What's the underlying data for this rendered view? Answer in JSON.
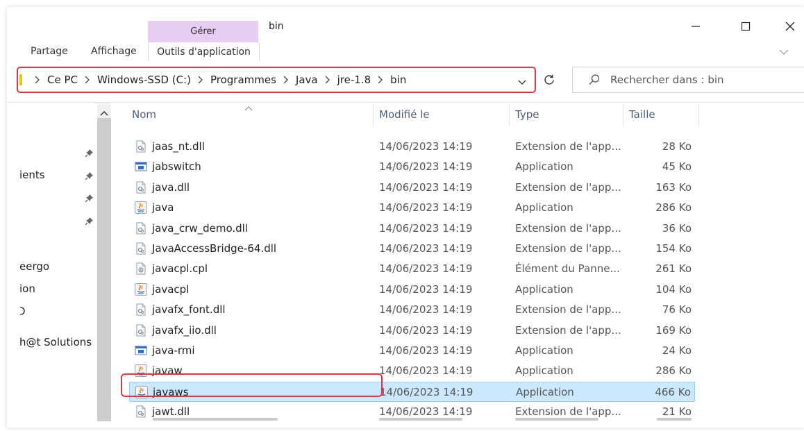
{
  "window": {
    "title": "bin",
    "context_group": "Gérer",
    "tabs": [
      "Partage",
      "Affichage",
      "Outils d'application"
    ]
  },
  "address_bar": {
    "crumbs": [
      "Ce PC",
      "Windows-SSD (C:)",
      "Programmes",
      "Java",
      "jre-1.8",
      "bin"
    ]
  },
  "search": {
    "placeholder": "Rechercher dans : bin"
  },
  "nav_pane": {
    "items": [
      "ients",
      "eergo",
      "ion",
      "",
      "h@t Solutions"
    ]
  },
  "columns": {
    "name": "Nom",
    "modified": "Modifié le",
    "type": "Type",
    "size": "Taille"
  },
  "files": [
    {
      "name": "jaas_nt.dll",
      "date": "14/06/2023 14:19",
      "type": "Extension de l'app...",
      "size": "28 Ko",
      "icon": "dll-file-icon"
    },
    {
      "name": "jabswitch",
      "date": "14/06/2023 14:19",
      "type": "Application",
      "size": "45 Ko",
      "icon": "app-window-icon"
    },
    {
      "name": "java.dll",
      "date": "14/06/2023 14:19",
      "type": "Extension de l'app...",
      "size": "163 Ko",
      "icon": "dll-file-icon"
    },
    {
      "name": "java",
      "date": "14/06/2023 14:19",
      "type": "Application",
      "size": "286 Ko",
      "icon": "java-app-icon"
    },
    {
      "name": "java_crw_demo.dll",
      "date": "14/06/2023 14:19",
      "type": "Extension de l'app...",
      "size": "36 Ko",
      "icon": "dll-file-icon"
    },
    {
      "name": "JavaAccessBridge-64.dll",
      "date": "14/06/2023 14:19",
      "type": "Extension de l'app...",
      "size": "154 Ko",
      "icon": "dll-file-icon"
    },
    {
      "name": "javacpl.cpl",
      "date": "14/06/2023 14:19",
      "type": "Élément du Panne...",
      "size": "261 Ko",
      "icon": "cpl-file-icon"
    },
    {
      "name": "javacpl",
      "date": "14/06/2023 14:19",
      "type": "Application",
      "size": "104 Ko",
      "icon": "java-app-icon"
    },
    {
      "name": "javafx_font.dll",
      "date": "14/06/2023 14:19",
      "type": "Extension de l'app...",
      "size": "76 Ko",
      "icon": "dll-file-icon"
    },
    {
      "name": "javafx_iio.dll",
      "date": "14/06/2023 14:19",
      "type": "Extension de l'app...",
      "size": "169 Ko",
      "icon": "dll-file-icon"
    },
    {
      "name": "java-rmi",
      "date": "14/06/2023 14:19",
      "type": "Application",
      "size": "24 Ko",
      "icon": "app-window-icon"
    },
    {
      "name": "javaw",
      "date": "14/06/2023 14:19",
      "type": "Application",
      "size": "286 Ko",
      "icon": "java-app-icon"
    },
    {
      "name": "javaws",
      "date": "14/06/2023 14:19",
      "type": "Application",
      "size": "466 Ko",
      "icon": "java-app-icon",
      "selected": true
    },
    {
      "name": "jawt.dll",
      "date": "14/06/2023 14:19",
      "type": "Extension de l'app...",
      "size": "21 Ko",
      "icon": "dll-file-icon"
    }
  ],
  "colors": {
    "context_tab": "#e8cdf2",
    "selection": "#cce8ff",
    "selection_border": "#99d1ff",
    "annotation": "#e4343d",
    "header_text": "#4b5f7a"
  }
}
